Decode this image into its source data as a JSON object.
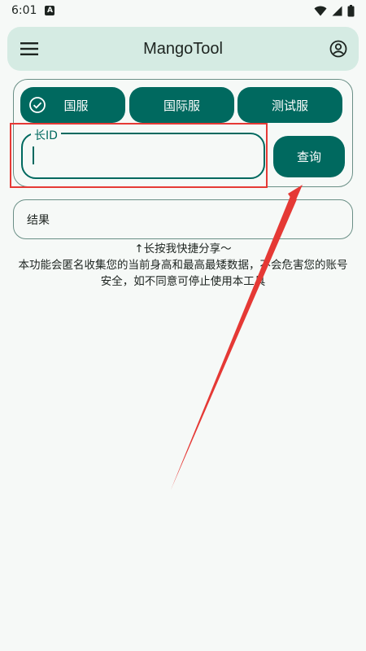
{
  "status": {
    "time": "6:01",
    "notification_badge": "A"
  },
  "app_bar": {
    "title": "MangoTool"
  },
  "server_tabs": [
    {
      "label": "国服",
      "selected": true
    },
    {
      "label": "国际服",
      "selected": false
    },
    {
      "label": "测试服",
      "selected": false
    }
  ],
  "id_field": {
    "label": "长ID",
    "value": ""
  },
  "query_button": {
    "label": "查询"
  },
  "result": {
    "label": "结果"
  },
  "hint": {
    "line1": "↑长按我快捷分享～",
    "line2": "本功能会匿名收集您的当前身高和最高最矮数据，不会危害您的账号安全，如不同意可停止使用本工具"
  },
  "colors": {
    "primary": "#00695f",
    "app_bar_bg": "#d5ebe3",
    "annotation": "#e53935"
  },
  "icons": [
    "menu-icon",
    "account-icon",
    "check-circle-icon",
    "wifi-icon",
    "signal-icon",
    "battery-icon"
  ]
}
